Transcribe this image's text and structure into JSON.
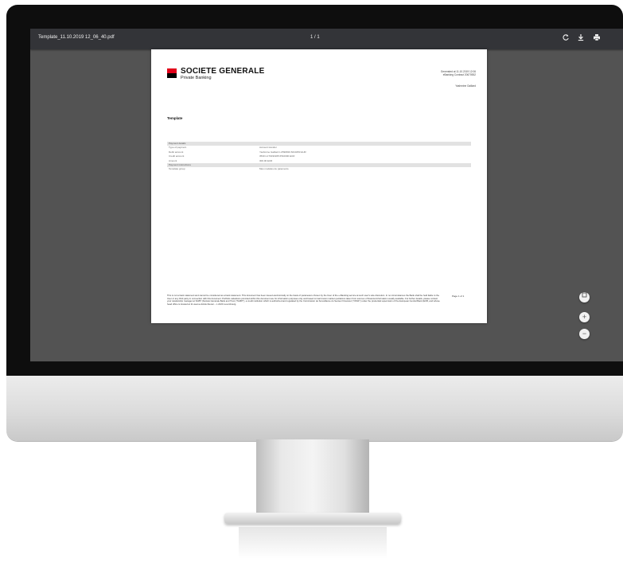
{
  "viewer": {
    "file_name": "Template_11.10.2019 12_06_40.pdf",
    "page_indicator": "1 / 1",
    "icons": {
      "rotate": "rotate-icon",
      "download": "download-icon",
      "print": "print-icon"
    },
    "zoom": {
      "fit_icon": "fit-to-page-icon",
      "zoom_in": "+",
      "zoom_out": "−"
    }
  },
  "pdf": {
    "brand": {
      "name": "SOCIETE GENERALE",
      "subtitle": "Private Banking",
      "logo_colors": [
        "#e2001a",
        "#000000"
      ]
    },
    "generated": {
      "line1": "Generated at 11.10.2019 12:06",
      "line2": "eBanking Contract 20670552",
      "user": "Yashmine Gaillard"
    },
    "title": "Template",
    "sections": {
      "payment_details": "Payment details",
      "payment_instructions": "Payment instructions"
    },
    "rows": {
      "type_label": "Type of payment",
      "type_value": "Account transfer",
      "debit_label": "Debit account",
      "debit_value": "Yashmine Gaillard LU590819 6010250 EUR",
      "credit_label": "Credit account",
      "credit_value": "3530 LU70191965 6510000 EUR",
      "amount_label": "Amount",
      "amount_value": "300.00 EUR",
      "group_label": "Template group",
      "group_value": "Mes modèles de paiements"
    },
    "footer": "This is not a bank statement and cannot be considered as a bank statement. This document has been issued electronically on the basis of parameters chosen by the User of the e-Banking service at such user's sole discretion. In no circumstances the Bank shall be held liable to the User or any third party in connection with this document. Portfolio valuations provided within this document are for information purposes only and based on last known market quotations taken from sources of financial information usually available. For further details, please contact your relationship manager at SGBT (Société Générale Bank and Trust (\"SGBT\"), a credit institution which is authorized and regulated by the Commission de Surveillance du Secteur Financier (\"CSSF\") under the prudential supervision of the European Central Bank (ECB, and whose head office is located at 11 avenue Emile Reuter – L 2420 Luxembourg.",
    "page_label": "Page 1 of 1"
  }
}
